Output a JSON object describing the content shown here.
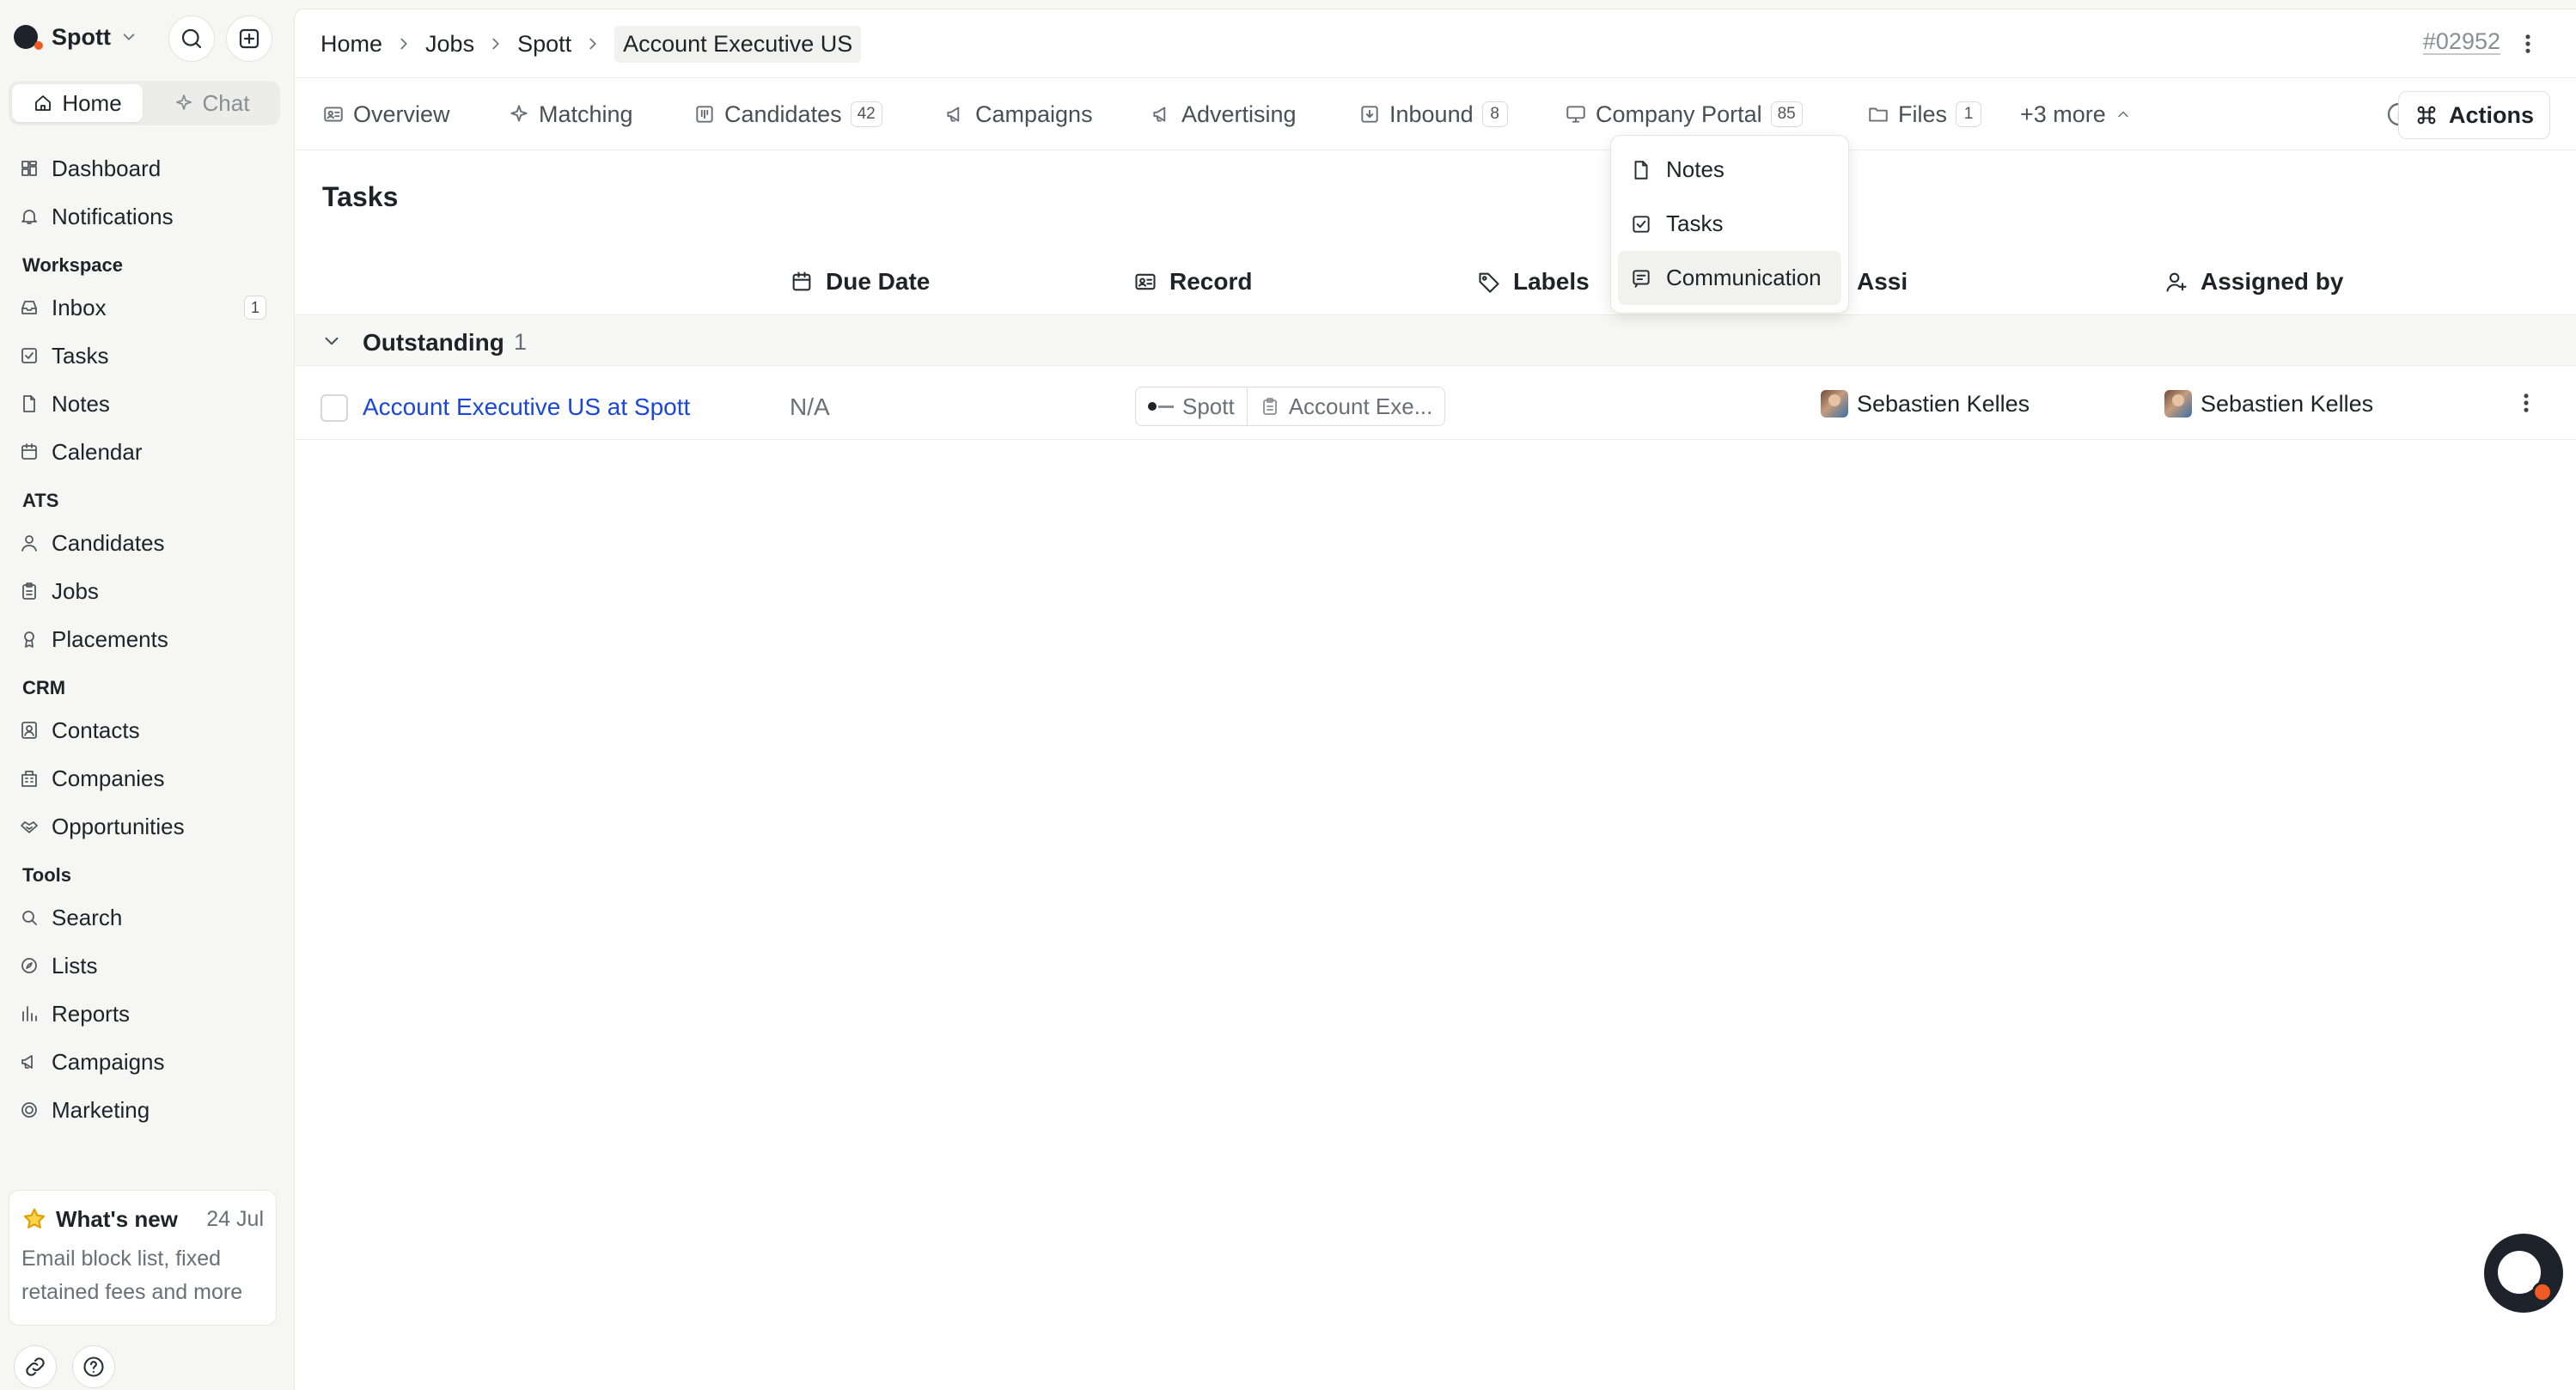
{
  "brand": {
    "name": "Spott"
  },
  "sidebar": {
    "seg": {
      "home": "Home",
      "chat": "Chat"
    },
    "items": [
      {
        "label": "Dashboard"
      },
      {
        "label": "Notifications"
      }
    ],
    "workspace_title": "Workspace",
    "workspace": [
      {
        "label": "Inbox",
        "badge": "1"
      },
      {
        "label": "Tasks"
      },
      {
        "label": "Notes"
      },
      {
        "label": "Calendar"
      }
    ],
    "ats_title": "ATS",
    "ats": [
      {
        "label": "Candidates"
      },
      {
        "label": "Jobs"
      },
      {
        "label": "Placements"
      }
    ],
    "crm_title": "CRM",
    "crm": [
      {
        "label": "Contacts"
      },
      {
        "label": "Companies"
      },
      {
        "label": "Opportunities"
      }
    ],
    "tools_title": "Tools",
    "tools": [
      {
        "label": "Search"
      },
      {
        "label": "Lists"
      },
      {
        "label": "Reports"
      },
      {
        "label": "Campaigns"
      },
      {
        "label": "Marketing"
      }
    ],
    "whats_new": {
      "title": "What's new",
      "date": "24 Jul",
      "body": "Email block list, fixed retained fees and more"
    }
  },
  "breadcrumb": [
    "Home",
    "Jobs",
    "Spott",
    "Account Executive US"
  ],
  "record_id": "#02952",
  "tabs": [
    {
      "label": "Overview"
    },
    {
      "label": "Matching"
    },
    {
      "label": "Candidates",
      "count": "42"
    },
    {
      "label": "Campaigns"
    },
    {
      "label": "Advertising"
    },
    {
      "label": "Inbound",
      "count": "8"
    },
    {
      "label": "Company Portal",
      "count": "85"
    },
    {
      "label": "Files",
      "count": "1"
    },
    {
      "label": "+3 more"
    }
  ],
  "actions_label": "Actions",
  "dropdown": [
    "Notes",
    "Tasks",
    "Communication"
  ],
  "section_title": "Tasks",
  "columns": {
    "due_date": "Due Date",
    "record": "Record",
    "labels": "Labels",
    "assigned_to": "Assi",
    "assigned_by": "Assigned by"
  },
  "group": {
    "label": "Outstanding",
    "count": "1"
  },
  "task": {
    "title": "Account Executive US at Spott",
    "due": "N/A",
    "record_company": "Spott",
    "record_job": "Account Exe...",
    "assigned_to": "Sebastien Kelles",
    "assigned_by": "Sebastien Kelles"
  },
  "colors": {
    "link": "#1a47d8",
    "brand_dark": "#1e232b",
    "brand_orange": "#f05a23"
  }
}
